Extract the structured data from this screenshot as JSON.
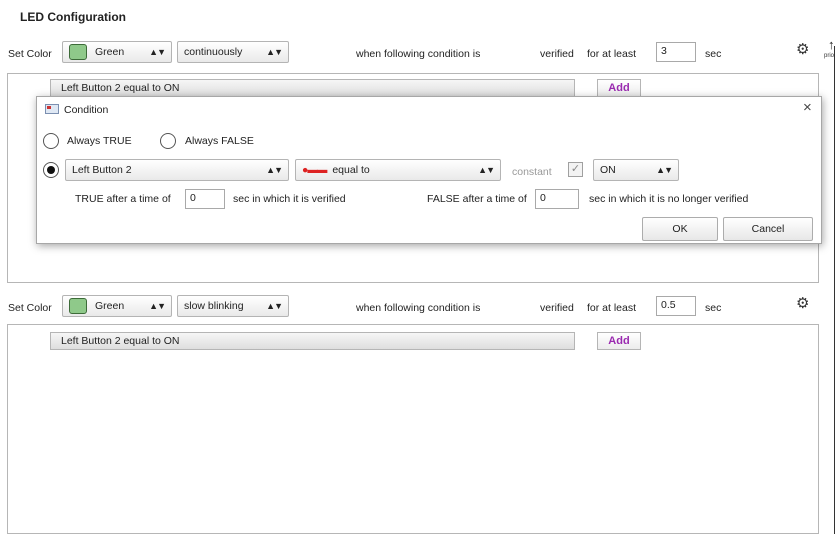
{
  "page_title": "LED Configuration",
  "block1": {
    "set_color_label": "Set Color",
    "color": "Green",
    "color_hex": "#8fc98a",
    "mode": "continuously",
    "condition_label": "when following condition is",
    "verified_label": "verified",
    "for_at_least_label": "for at least",
    "duration": "3",
    "sec_label": "sec",
    "condition_bar": "Left Button 2  equal to  ON",
    "add_label": "Add"
  },
  "dialog": {
    "title": "Condition",
    "close_symbol": "×",
    "always_true": "Always TRUE",
    "always_false": "Always FALSE",
    "source": "Left Button 2",
    "operator": "equal to",
    "constant_label": "constant",
    "constant_checked": true,
    "value": "ON",
    "true_after_label": "TRUE after a time of",
    "true_time": "0",
    "true_sec_label": "sec   in which it is verified",
    "false_after_label": "FALSE after a time of",
    "false_time": "0",
    "false_sec_label": "sec   in which it is no longer verified",
    "ok_label": "OK",
    "cancel_label": "Cancel"
  },
  "block2": {
    "set_color_label": "Set Color",
    "color": "Green",
    "color_hex": "#8fc98a",
    "mode": "slow blinking",
    "condition_label": "when following condition is",
    "verified_label": "verified",
    "for_at_least_label": "for at least",
    "duration": "0.5",
    "sec_label": "sec",
    "condition_bar": "Left Button 2  equal to  ON",
    "add_label": "Add"
  },
  "side": {
    "priority_label": "prio"
  }
}
